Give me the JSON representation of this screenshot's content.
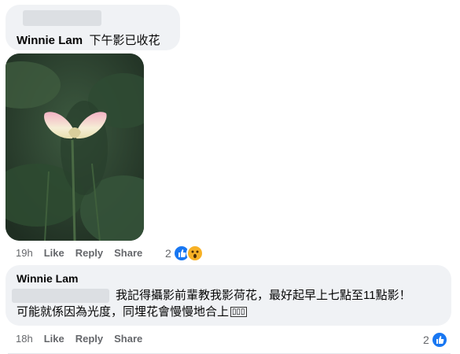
{
  "comment1": {
    "author": "Winnie Lam",
    "text": "下午影已收花",
    "time": "19h",
    "like_label": "Like",
    "reply_label": "Reply",
    "share_label": "Share",
    "reaction_count": "2",
    "reactions": [
      "like-icon",
      "wow-icon"
    ],
    "photo_desc": "lotus-bud-photo"
  },
  "comment2": {
    "author": "Winnie Lam",
    "text_line1": "我記得攝影前輩教我影荷花，最好起早上七點至11點影！",
    "text_line2": "可能就係因為光度，同埋花會慢慢地合上",
    "emoji": "▯▯▯",
    "time": "18h",
    "like_label": "Like",
    "reply_label": "Reply",
    "share_label": "Share",
    "reaction_count": "2",
    "reactions": [
      "like-icon"
    ]
  },
  "colors": {
    "bubble": "#f0f2f5",
    "meta": "#65676b",
    "like": "#1877f2",
    "wow": "#f7b125"
  }
}
